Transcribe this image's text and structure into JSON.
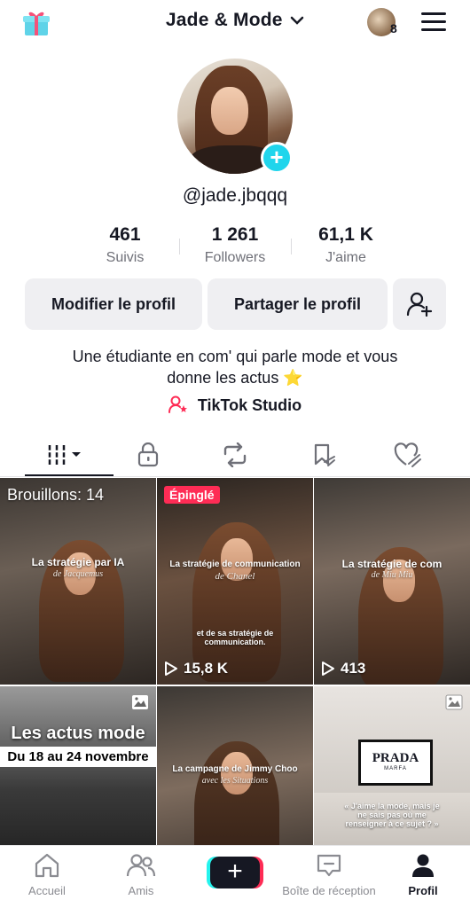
{
  "header": {
    "title": "Jade & Mode",
    "story_count": "8"
  },
  "profile": {
    "handle": "@jade.jbqqq",
    "stats": [
      {
        "value": "461",
        "label": "Suivis"
      },
      {
        "value": "1 261",
        "label": "Followers"
      },
      {
        "value": "61,1 K",
        "label": "J'aime"
      }
    ],
    "buttons": {
      "edit": "Modifier le profil",
      "share": "Partager le profil"
    },
    "bio_line1": "Une étudiante en com' qui parle mode et vous",
    "bio_line2": "donne les actus ⭐",
    "studio_link": "TikTok Studio"
  },
  "tabs": [
    "videos-tab",
    "private-tab",
    "reposts-tab",
    "favorites-tab",
    "liked-tab"
  ],
  "grid": {
    "drafts_label": "Brouillons: 14",
    "items": [
      {
        "title": "La stratégie par IA",
        "subtitle": "de Jacquemus"
      },
      {
        "badge": "Épinglé",
        "title": "La stratégie de communication",
        "subtitle": "de Chanel",
        "caption": "et de sa stratégie de communication.",
        "views": "15,8 K"
      },
      {
        "title": "La stratégie de com",
        "subtitle": "de Miu Miu",
        "views": "413"
      },
      {
        "headline": "Les actus mode",
        "date_band": "Du 18 au 24 novembre"
      },
      {
        "title": "La campagne de Jimmy Choo",
        "subtitle": "avec les Situations"
      },
      {
        "brand": "PRADA",
        "brand_sub": "MARFA",
        "quote": "« J'aime la mode, mais je ne sais pas où me renseigner à ce sujet ? »"
      }
    ]
  },
  "nav": [
    {
      "label": "Accueil"
    },
    {
      "label": "Amis"
    },
    {
      "label": "+"
    },
    {
      "label": "Boîte de réception"
    },
    {
      "label": "Profil"
    }
  ],
  "colors": {
    "accent": "#20d5ec",
    "pinned": "#fe2c55",
    "button_bg": "#efeff2"
  }
}
